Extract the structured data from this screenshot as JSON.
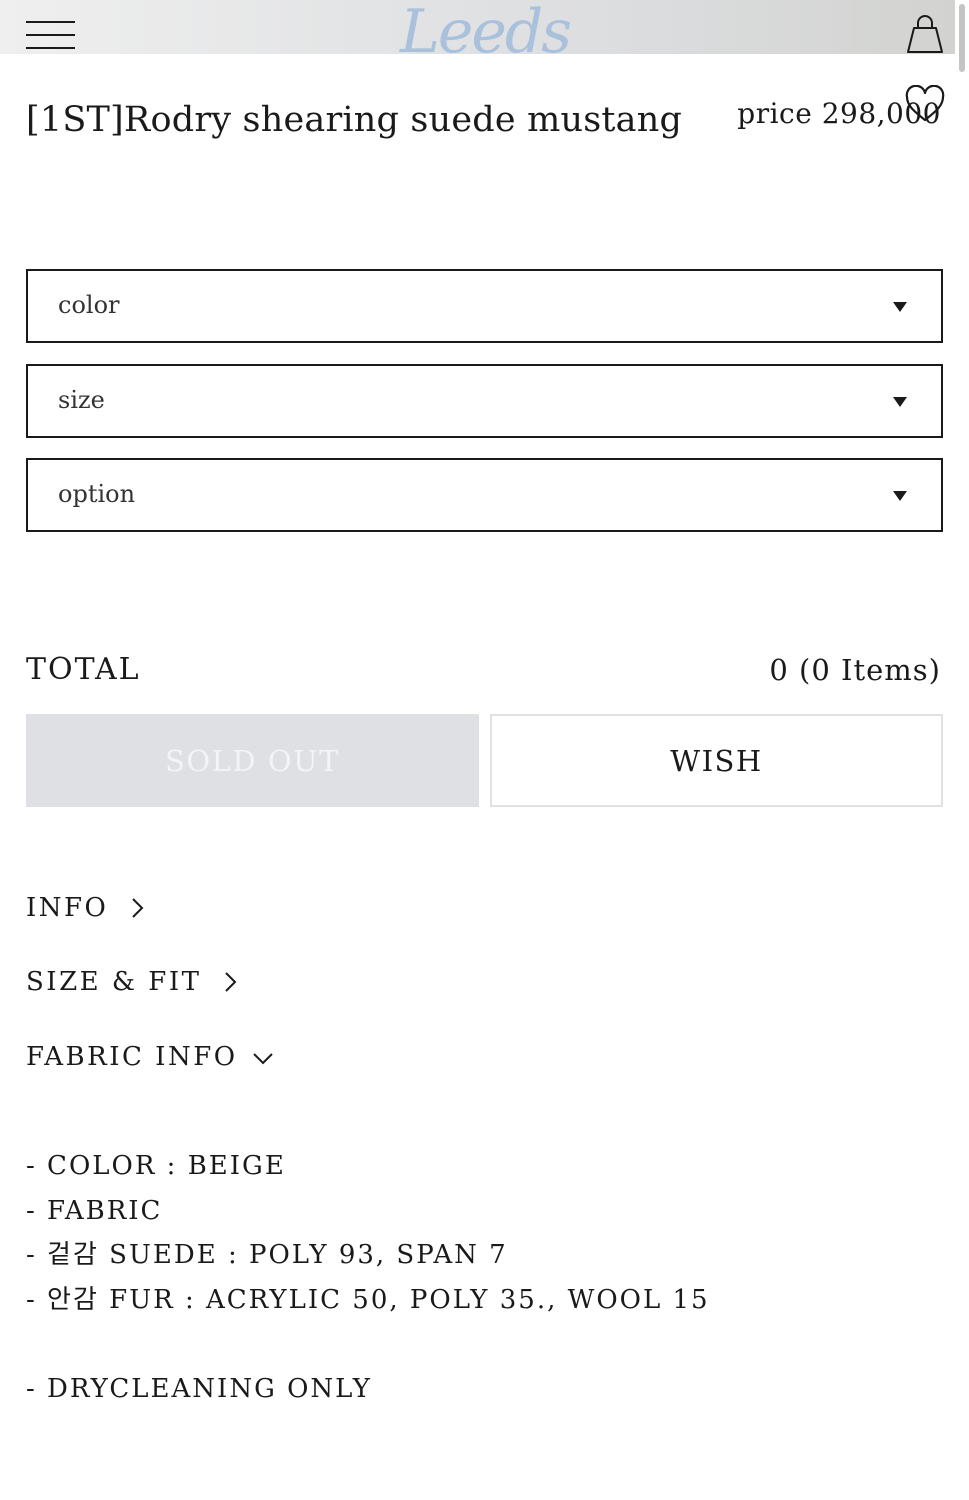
{
  "header": {
    "logo_text": "Leeds",
    "menu_icon": "hamburger-menu-icon",
    "cart_icon": "shopping-bag-icon",
    "wish_icon": "heart-icon"
  },
  "product": {
    "title": "[1ST]Rodry shearing suede mustang",
    "price": "price 298,000"
  },
  "options": {
    "color_label": "color",
    "size_label": "size",
    "option_label": "option"
  },
  "total": {
    "label": "TOTAL",
    "value": "0 (0 Items)"
  },
  "buttons": {
    "soldout_label": "SOLD OUT",
    "wish_label": "WISH"
  },
  "accordion": {
    "info_label": "INFO",
    "size_fit_label": "SIZE & FIT",
    "fabric_info_label": "FABRIC INFO"
  },
  "fabric_info": {
    "lines": [
      "- COLOR : BEIGE",
      "- FABRIC",
      "- 겉감 SUEDE : POLY 93, SPAN 7",
      "- 안감 FUR : ACRYLIC 50, POLY 35., WOOL 15",
      "- DRYCLEANING ONLY"
    ]
  },
  "colors": {
    "logo": "#a9c1dc",
    "soldout_bg": "#dfe0e4",
    "text": "#1a1a1a"
  }
}
